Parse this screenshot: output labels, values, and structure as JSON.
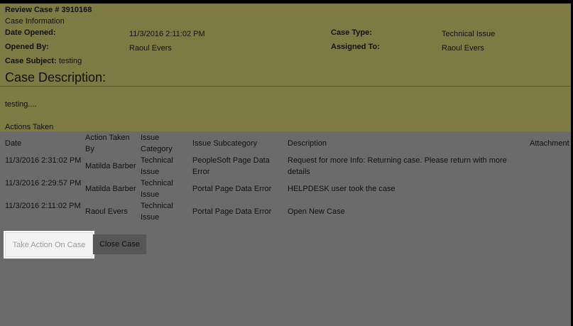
{
  "header": {
    "review_case": "Review Case # 3910168",
    "section_title": "Case Information"
  },
  "fields": {
    "date_opened_label": "Date Opened:",
    "date_opened_value": "11/3/2016 2:11:02 PM",
    "case_type_label": "Case Type:",
    "case_type_value": "Technical Issue",
    "opened_by_label": "Opened By:",
    "opened_by_value": "Raoul Evers",
    "assigned_to_label": "Assigned To:",
    "assigned_to_value": "Raoul Evers",
    "case_subject_label": "Case Subject:",
    "case_subject_value": "testing"
  },
  "description": {
    "heading": "Case Description:",
    "text": "testing...."
  },
  "actions": {
    "title": "Actions Taken",
    "columns": {
      "date": "Date",
      "action_taken_by": "Action Taken By",
      "issue_category": "Issue Category",
      "issue_subcategory": "Issue Subcategory",
      "description": "Description",
      "attachment": "Attachment"
    },
    "rows": [
      {
        "date": "11/3/2016 2:31:02 PM",
        "by": "Matilda Barber",
        "category": "Technical Issue",
        "subcategory": "PeopleSoft Page Data Error",
        "description": "Request for more Info: Returning case. Please return with more details"
      },
      {
        "date": "11/3/2016 2:29:57 PM",
        "by": "Matilda Barber",
        "category": "Technical Issue",
        "subcategory": "Portal Page Data Error",
        "description": "HELPDESK user took the case"
      },
      {
        "date": "11/3/2016 2:11:02 PM",
        "by": "Raoul Evers",
        "category": "Technical Issue",
        "subcategory": "Portal Page Data Error",
        "description": "Open New Case"
      }
    ]
  },
  "buttons": {
    "take_action": "Take Action On Case",
    "close_case": "Close Case"
  }
}
